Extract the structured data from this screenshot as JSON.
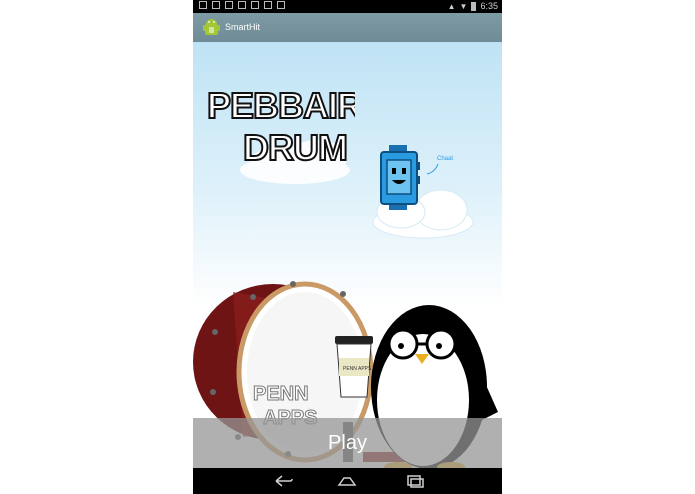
{
  "status_bar": {
    "time": "6:35"
  },
  "action_bar": {
    "app_title": "SmartHit"
  },
  "logo_text": {
    "line1": "PEBBAIR",
    "line2": "DRUM"
  },
  "robot_speech": "Chaat",
  "drum_text": {
    "line1": "PENN",
    "line2": "APPS"
  },
  "cup_text": "PENN APPS",
  "play_button": {
    "label": "Play"
  },
  "colors": {
    "sky": "#bfe3f5",
    "drum_red": "#8b1e1e",
    "robot_blue": "#2a9be0",
    "action_bar": "#7e9ba5"
  }
}
